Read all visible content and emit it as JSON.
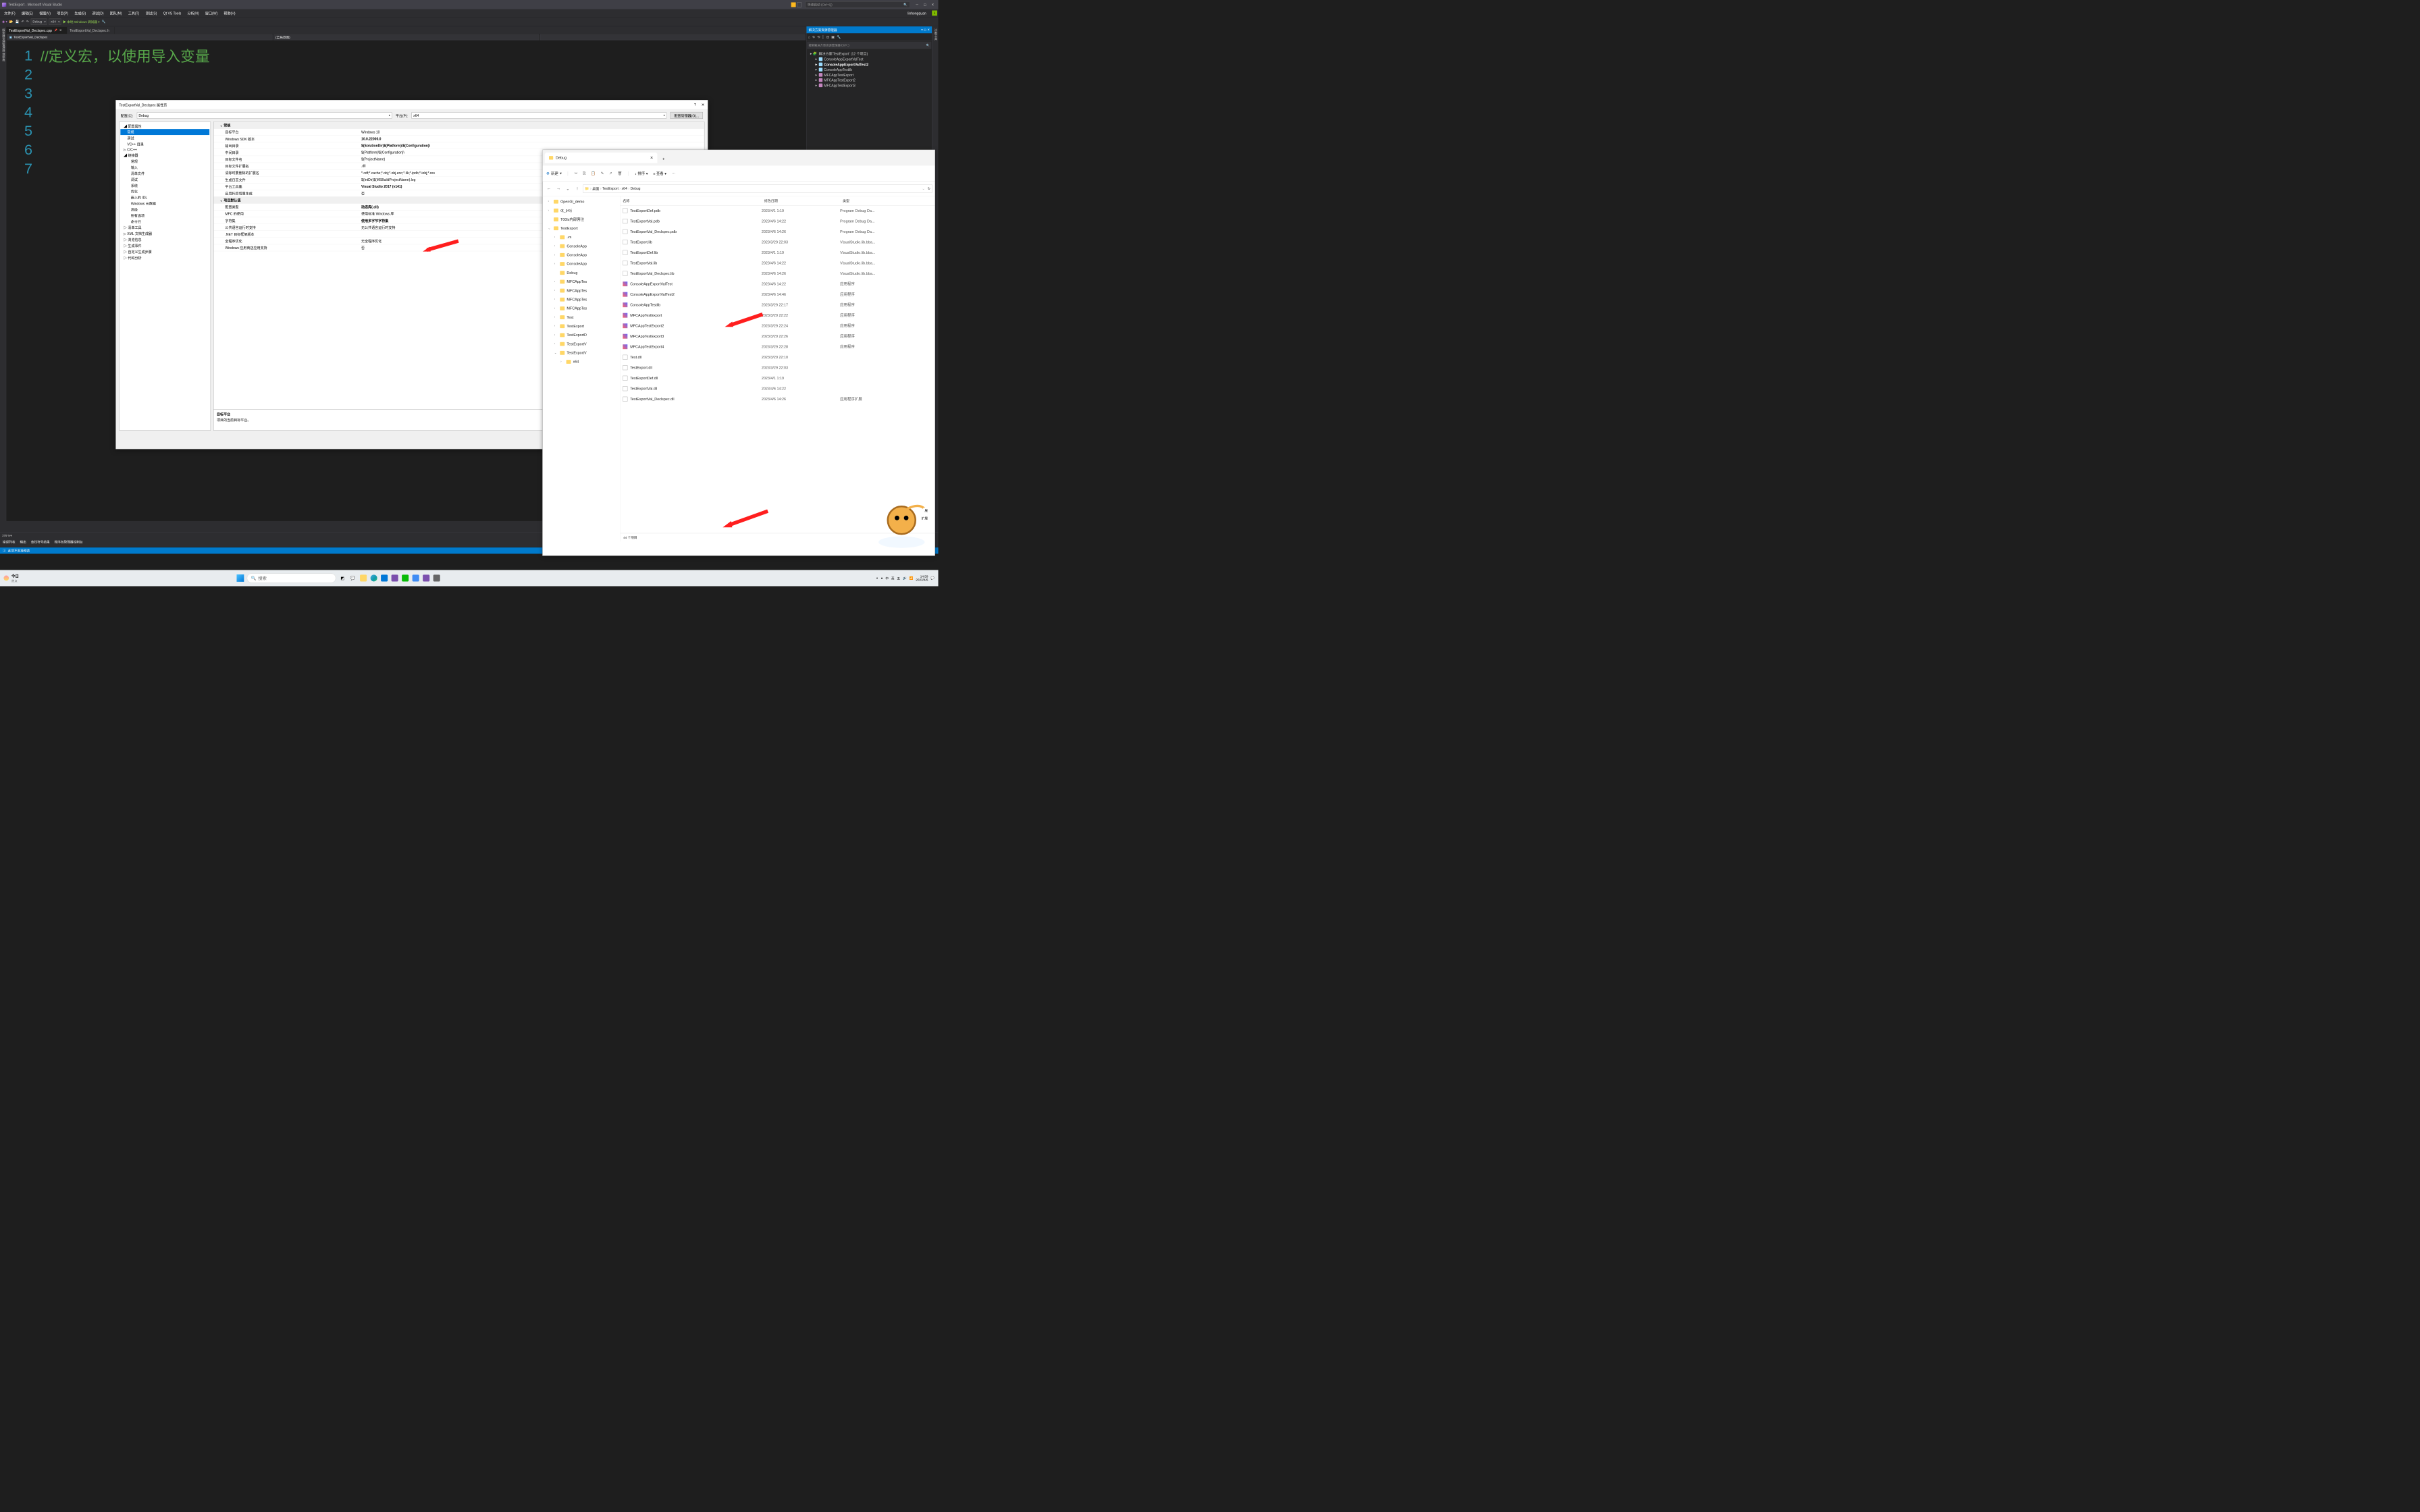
{
  "vs": {
    "title": "TestExport - Microsoft Visual Studio",
    "search_placeholder": "快速启动 (Ctrl+Q)",
    "username": "linhongquan",
    "user_initial": "L",
    "menu": [
      "文件(F)",
      "编辑(E)",
      "视图(V)",
      "项目(P)",
      "生成(B)",
      "调试(D)",
      "团队(M)",
      "工具(T)",
      "测试(S)",
      "Qt VS Tools",
      "分析(N)",
      "窗口(W)",
      "帮助(H)"
    ],
    "toolbar": {
      "config": "Debug",
      "platform": "x64",
      "run": "本地 Windows 调试器"
    },
    "tabs": [
      {
        "label": "TestExportVal_Declspec.cpp",
        "active": true,
        "pinned": true
      },
      {
        "label": "TestExportVal_Declspec.h",
        "active": false
      }
    ],
    "nav_scope": "TestExportVal_Declspec",
    "nav_scope2": "(全局范围)",
    "code_lines": [
      "1",
      "2",
      "3",
      "4",
      "5",
      "6",
      "7"
    ],
    "code_text": "//定义宏，以使用导入变量",
    "zoom": "376 %",
    "bottom_tabs": [
      "错误列表",
      "输出",
      "查找符号结果",
      "程序包管理器控制台"
    ],
    "left_rail": "服务器资源管理器 源探邀",
    "right_rail": "诊断工具",
    "status_msg": "此项不支持预览"
  },
  "sol": {
    "title": "解决方案资源管理器",
    "search": "搜索解决方案资源管理器(Ctrl+;)",
    "root": "解决方案'TestExport' (12 个项目)",
    "items": [
      {
        "label": "ConsoleAppExportValTest",
        "icon": "csharp"
      },
      {
        "label": "ConsoleAppExportValTest2",
        "icon": "csharp",
        "bold": true
      },
      {
        "label": "ConsoleAppTestlib",
        "icon": "csharp"
      },
      {
        "label": "MFCAppTestExport",
        "icon": "mfc"
      },
      {
        "label": "MFCAppTestExport2",
        "icon": "mfc"
      },
      {
        "label": "MFCAppTestExport3",
        "icon": "mfc"
      }
    ]
  },
  "prop": {
    "title": "TestExportVal_Declspec 属性页",
    "cfg_label": "配置(C):",
    "cfg_val": "Debug",
    "plat_label": "平台(P):",
    "plat_val": "x64",
    "mgr_btn": "配置管理器(O)...",
    "tree": {
      "root": "配置属性",
      "items": [
        "常规",
        "调试",
        "VC++ 目录",
        "C/C++"
      ],
      "linker": "链接器",
      "linker_sub": [
        "常规",
        "输入",
        "清单文件",
        "调试",
        "系统",
        "优化",
        "嵌入的 IDL",
        "Windows 元数据",
        "高级",
        "所有选项",
        "命令行"
      ],
      "rest": [
        "清单工具",
        "XML 文档生成器",
        "浏览信息",
        "生成事件",
        "自定义生成步骤",
        "代码分析"
      ]
    },
    "sections": [
      {
        "header": "常规",
        "rows": [
          {
            "l": "目标平台",
            "v": "Windows 10"
          },
          {
            "l": "Windows SDK 版本",
            "v": "10.0.22000.0",
            "b": true
          },
          {
            "l": "输出目录",
            "v": "$(SolutionDir)$(Platform)\\$(Configuration)\\",
            "b": true
          },
          {
            "l": "中间目录",
            "v": "$(Platform)\\$(Configuration)\\"
          },
          {
            "l": "目标文件名",
            "v": "$(ProjectName)"
          },
          {
            "l": "目标文件扩展名",
            "v": ".dll"
          },
          {
            "l": "清除时要删除的扩展名",
            "v": "*.cdf;*.cache;*.obj;*.obj.enc;*.ilk;*.ipdb;*.iobj;*.res"
          },
          {
            "l": "生成日志文件",
            "v": "$(IntDir)$(MSBuildProjectName).log"
          },
          {
            "l": "平台工具集",
            "v": "Visual Studio 2017 (v141)",
            "b": true
          },
          {
            "l": "启用托管增量生成",
            "v": "否"
          }
        ]
      },
      {
        "header": "项目默认值",
        "rows": [
          {
            "l": "配置类型",
            "v": "动态库(.dll)",
            "b": true,
            "highlight": true
          },
          {
            "l": "MFC 的使用",
            "v": "使用标准 Windows 库"
          },
          {
            "l": "字符集",
            "v": "使用多字节字符集",
            "b": true
          },
          {
            "l": "公共语言运行时支持",
            "v": "无公共语言运行时支持"
          },
          {
            "l": ".NET 目标框架版本",
            "v": ""
          },
          {
            "l": "全程序优化",
            "v": "无全程序优化"
          },
          {
            "l": "Windows 应用商店应用支持",
            "v": "否"
          }
        ]
      }
    ],
    "desc_title": "目标平台",
    "desc_body": "项目的当前目标平台。"
  },
  "explorer": {
    "tab": "Debug",
    "new_label": "新建",
    "sort_label": "排序",
    "view_label": "查看",
    "path": [
      "桌面",
      "TestExport",
      "x64",
      "Debug"
    ],
    "cols": [
      "名称",
      "修改日期",
      "类型"
    ],
    "tree": [
      {
        "l": "OpenGl_demo",
        "chev": "›"
      },
      {
        "l": "qt_proj",
        "chev": "›"
      },
      {
        "l": "T00ls内部旁注",
        "chev": ""
      },
      {
        "l": "TestExport",
        "chev": "⌄"
      },
      {
        "l": ".vs",
        "chev": "›",
        "sub": true
      },
      {
        "l": "ConsoleApp",
        "chev": "›",
        "sub": true
      },
      {
        "l": "ConsoleApp",
        "chev": "›",
        "sub": true
      },
      {
        "l": "ConsoleApp",
        "chev": "›",
        "sub": true
      },
      {
        "l": "Debug",
        "chev": "",
        "sub": true
      },
      {
        "l": "MFCAppTes",
        "chev": "›",
        "sub": true
      },
      {
        "l": "MFCAppTes",
        "chev": "›",
        "sub": true
      },
      {
        "l": "MFCAppTes",
        "chev": "›",
        "sub": true
      },
      {
        "l": "MFCAppTes",
        "chev": "›",
        "sub": true
      },
      {
        "l": "Test",
        "chev": "›",
        "sub": true
      },
      {
        "l": "TestExport",
        "chev": "›",
        "sub": true
      },
      {
        "l": "TestExportD",
        "chev": "›",
        "sub": true
      },
      {
        "l": "TestExportV",
        "chev": "›",
        "sub": true
      },
      {
        "l": "TestExportV",
        "chev": "⌄",
        "sub": true
      },
      {
        "l": "x64",
        "chev": "›",
        "sub2": true
      }
    ],
    "files": [
      {
        "n": "TestExportDef.pdb",
        "d": "2023/4/1 1:19",
        "t": "Program Debug Da...",
        "i": "pdb"
      },
      {
        "n": "TestExportVal.pdb",
        "d": "2023/4/6 14:22",
        "t": "Program Debug Da...",
        "i": "pdb"
      },
      {
        "n": "TestExportVal_Declspec.pdb",
        "d": "2023/4/6 14:26",
        "t": "Program Debug Da...",
        "i": "pdb"
      },
      {
        "n": "TestExport.lib",
        "d": "2023/3/29 22:03",
        "t": "VisualStudio.lib.bba...",
        "i": "lib"
      },
      {
        "n": "TestExportDef.lib",
        "d": "2023/4/1 1:19",
        "t": "VisualStudio.lib.bba...",
        "i": "lib"
      },
      {
        "n": "TestExportVal.lib",
        "d": "2023/4/6 14:22",
        "t": "VisualStudio.lib.bba...",
        "i": "lib"
      },
      {
        "n": "TestExportVal_Declspec.lib",
        "d": "2023/4/6 14:26",
        "t": "VisualStudio.lib.bba...",
        "i": "lib"
      },
      {
        "n": "ConsoleAppExportValTest",
        "d": "2023/4/6 14:22",
        "t": "应用程序",
        "i": "exe"
      },
      {
        "n": "ConsoleAppExportValTest2",
        "d": "2023/4/6 14:46",
        "t": "应用程序",
        "i": "exe"
      },
      {
        "n": "ConsoleAppTestlib",
        "d": "2023/3/29 22:17",
        "t": "应用程序",
        "i": "exe"
      },
      {
        "n": "MFCAppTestExport",
        "d": "2023/3/29 22:22",
        "t": "应用程序",
        "i": "exe"
      },
      {
        "n": "MFCAppTestExport2",
        "d": "2023/3/29 22:24",
        "t": "应用程序",
        "i": "exe"
      },
      {
        "n": "MFCAppTestExport3",
        "d": "2023/3/29 22:26",
        "t": "应用程序",
        "i": "exe"
      },
      {
        "n": "MFCAppTestExport4",
        "d": "2023/3/29 22:28",
        "t": "应用程序",
        "i": "exe"
      },
      {
        "n": "Test.dll",
        "d": "2023/3/29 22:10",
        "t": "",
        "i": "dll"
      },
      {
        "n": "TestExport.dll",
        "d": "2023/3/29 22:03",
        "t": "",
        "i": "dll"
      },
      {
        "n": "TestExportDef.dll",
        "d": "2023/4/1 1:19",
        "t": "",
        "i": "dll"
      },
      {
        "n": "TestExportVal.dll",
        "d": "2023/4/6 14:22",
        "t": "",
        "i": "dll"
      },
      {
        "n": "TestExportVal_Declspec.dll",
        "d": "2023/4/6 14:26",
        "t": "应用程序扩展",
        "i": "dll"
      }
    ],
    "status": "44 个项目",
    "side_cut": [
      "展",
      "扩展"
    ]
  },
  "taskbar": {
    "weather_title": "今日",
    "weather_sub": "热点",
    "search": "搜索",
    "tray": [
      "∧",
      "●",
      "中",
      "英",
      "五",
      "🔊",
      "📶"
    ],
    "time": "14:59",
    "date": "2023/4/6"
  }
}
